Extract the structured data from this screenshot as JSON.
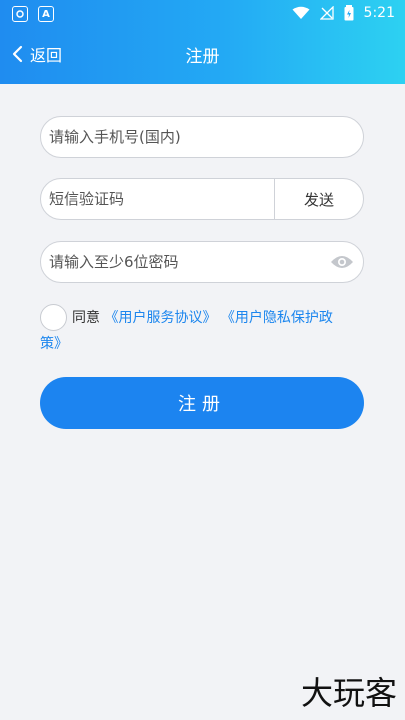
{
  "status_bar": {
    "left_icons": [
      "app-icon",
      "a-icon"
    ],
    "a_icon_text": "A",
    "time": "5:21"
  },
  "nav": {
    "back_label": "返回",
    "title": "注册"
  },
  "form": {
    "phone_placeholder": "请输入手机号(国内)",
    "sms_placeholder": "短信验证码",
    "send_label": "发送",
    "password_placeholder": "请输入至少6位密码"
  },
  "agreement": {
    "agree_label": "同意",
    "user_agreement": "《用户服务协议》",
    "privacy_part1": "《用户隐私保护政",
    "privacy_part2": "策》",
    "checked": false
  },
  "submit_label": "注册",
  "watermark": "大玩客",
  "colors": {
    "header_start": "#1f8cf0",
    "header_end": "#2dd1f2",
    "accent": "#1c84f0",
    "link": "#1c86ee",
    "background": "#f2f3f6"
  }
}
